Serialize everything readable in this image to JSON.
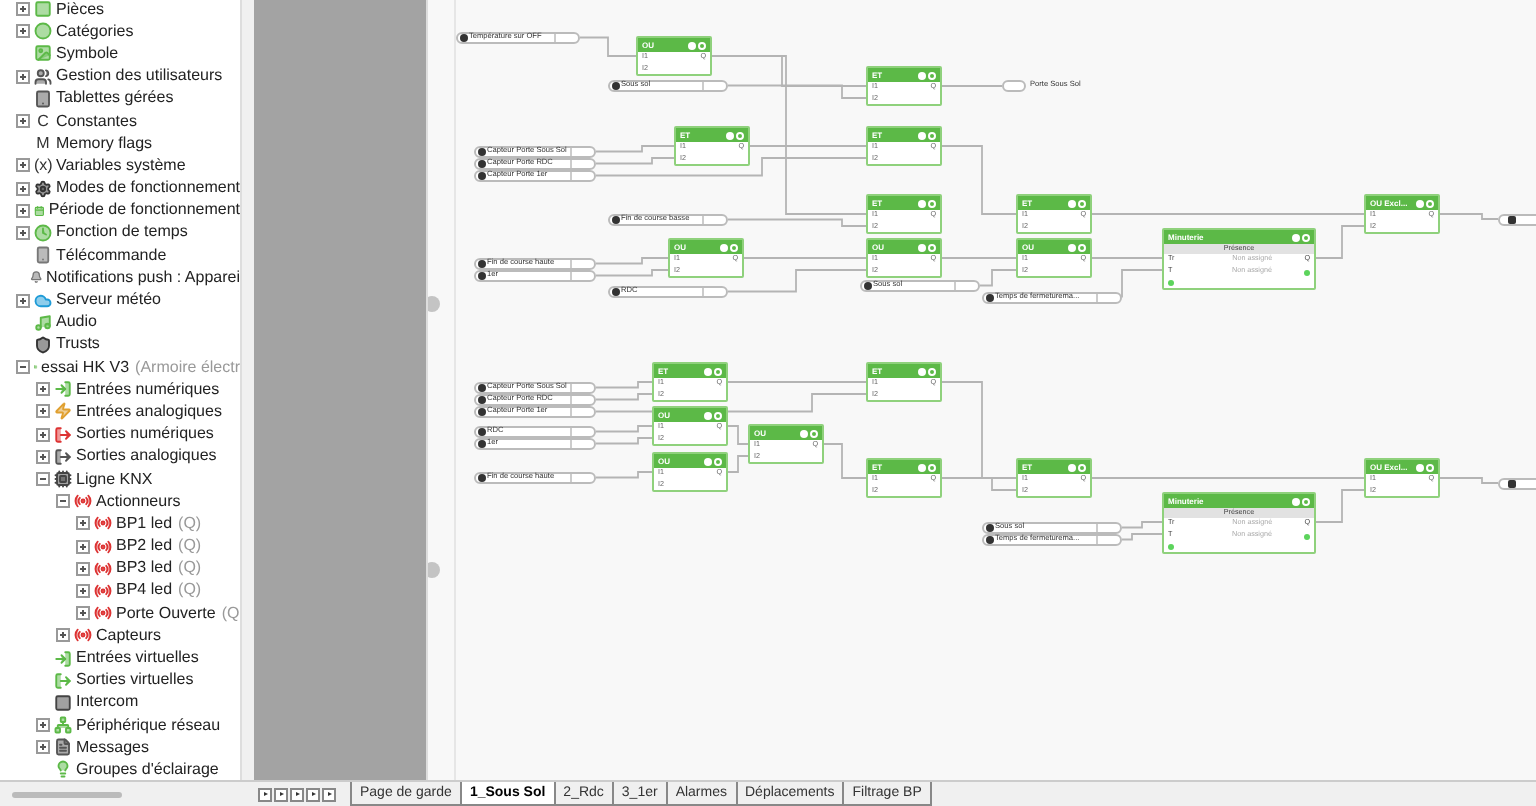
{
  "sidebar": {
    "tree": [
      {
        "label": "Pièces",
        "expanded": false
      },
      {
        "label": "Catégories",
        "expanded": false
      },
      {
        "label": "Symbole"
      },
      {
        "label": "Gestion des utilisateurs",
        "expanded": false
      },
      {
        "label": "Tablettes gérées"
      },
      {
        "label": "Constantes",
        "glyph": "C",
        "expanded": false
      },
      {
        "label": "Memory flags",
        "glyph": "M"
      },
      {
        "label": "Variables système",
        "glyph": "(x)",
        "expanded": false
      },
      {
        "label": "Modes de fonctionnement",
        "expanded": false
      },
      {
        "label": "Période de fonctionnement",
        "expanded": false
      },
      {
        "label": "Fonction de temps",
        "expanded": false
      },
      {
        "label": "Télécommande"
      },
      {
        "label": "Notifications push : Apparei"
      },
      {
        "label": "Serveur météo",
        "expanded": false
      },
      {
        "label": "Audio"
      },
      {
        "label": "Trusts"
      },
      {
        "label": "essai HK V3",
        "suffix": "(Armoire électr",
        "expanded": true,
        "children": [
          {
            "label": "Entrées numériques",
            "expanded": false
          },
          {
            "label": "Entrées analogiques",
            "expanded": false
          },
          {
            "label": "Sorties numériques",
            "expanded": false
          },
          {
            "label": "Sorties analogiques",
            "expanded": false
          },
          {
            "label": "Ligne KNX",
            "expanded": true,
            "children": [
              {
                "label": "Actionneurs",
                "expanded": true,
                "children": [
                  {
                    "label": "BP1 led",
                    "suffix": "(Q)",
                    "expanded": false
                  },
                  {
                    "label": "BP2 led",
                    "suffix": "(Q)",
                    "expanded": false
                  },
                  {
                    "label": "BP3 led",
                    "suffix": "(Q)",
                    "expanded": false
                  },
                  {
                    "label": "BP4 led",
                    "suffix": "(Q)",
                    "expanded": false
                  },
                  {
                    "label": "Porte Ouverte",
                    "suffix": "(Q",
                    "expanded": false
                  }
                ]
              },
              {
                "label": "Capteurs",
                "expanded": false
              }
            ]
          },
          {
            "label": "Entrées virtuelles"
          },
          {
            "label": "Sorties virtuelles"
          },
          {
            "label": "Intercom"
          },
          {
            "label": "Périphérique réseau",
            "expanded": false
          },
          {
            "label": "Messages",
            "expanded": false
          },
          {
            "label": "Groupes d'éclairage"
          }
        ]
      }
    ]
  },
  "diagram": {
    "inputs": [
      {
        "label": "Température sur OFF"
      },
      {
        "label": "Sous sol"
      },
      {
        "label": "Capteur Porte Sous Sol"
      },
      {
        "label": "Capteur Porte RDC"
      },
      {
        "label": "Capteur Porte 1er"
      },
      {
        "label": "Fin de course basse"
      },
      {
        "label": "Fin de course haute"
      },
      {
        "label": "1er"
      },
      {
        "label": "RDC"
      },
      {
        "label": "Sous sol"
      },
      {
        "label": "Temps de fermeturema..."
      },
      {
        "label": "Capteur Porte Sous Sol"
      },
      {
        "label": "Capteur Porte RDC"
      },
      {
        "label": "Capteur Porte 1er"
      },
      {
        "label": "RDC"
      },
      {
        "label": "1er"
      },
      {
        "label": "Fin de course haute"
      },
      {
        "label": "Sous sol"
      },
      {
        "label": "Temps de fermeturema..."
      }
    ],
    "outputs": [
      {
        "label": "Porte Sous Sol"
      }
    ],
    "blocks": [
      {
        "kind": "logic",
        "title": "OU",
        "inputs": [
          "I1",
          "I2"
        ],
        "output": "Q"
      },
      {
        "kind": "logic",
        "title": "ET",
        "inputs": [
          "I1",
          "I2"
        ],
        "output": "Q"
      },
      {
        "kind": "logic",
        "title": "ET",
        "inputs": [
          "I1",
          "I2"
        ],
        "output": "Q"
      },
      {
        "kind": "logic",
        "title": "ET",
        "inputs": [
          "I1",
          "I2"
        ],
        "output": "Q"
      },
      {
        "kind": "logic",
        "title": "ET",
        "inputs": [
          "I1",
          "I2"
        ],
        "output": "Q"
      },
      {
        "kind": "logic",
        "title": "ET",
        "inputs": [
          "I1",
          "I2"
        ],
        "output": "Q"
      },
      {
        "kind": "logic",
        "title": "OU Excl...",
        "inputs": [
          "I1",
          "I2"
        ],
        "output": "Q"
      },
      {
        "kind": "logic",
        "title": "OU",
        "inputs": [
          "I1",
          "I2"
        ],
        "output": "Q"
      },
      {
        "kind": "logic",
        "title": "OU",
        "inputs": [
          "I1",
          "I2"
        ],
        "output": "Q"
      },
      {
        "kind": "logic",
        "title": "OU",
        "inputs": [
          "I1",
          "I2"
        ],
        "output": "Q"
      },
      {
        "kind": "timer",
        "title": "Minuterie",
        "subtitle": "Présence",
        "rows": [
          {
            "pin": "Tr",
            "value": "Non assigné",
            "output": "Q"
          },
          {
            "pin": "T",
            "value": "Non assigné"
          }
        ]
      },
      {
        "kind": "logic",
        "title": "ET",
        "inputs": [
          "I1",
          "I2"
        ],
        "output": "Q"
      },
      {
        "kind": "logic",
        "title": "ET",
        "inputs": [
          "I1",
          "I2"
        ],
        "output": "Q"
      },
      {
        "kind": "logic",
        "title": "OU",
        "inputs": [
          "I1",
          "I2"
        ],
        "output": "Q"
      },
      {
        "kind": "logic",
        "title": "OU",
        "inputs": [
          "I1",
          "I2"
        ],
        "output": "Q"
      },
      {
        "kind": "logic",
        "title": "OU",
        "inputs": [
          "I1",
          "I2"
        ],
        "output": "Q"
      },
      {
        "kind": "logic",
        "title": "ET",
        "inputs": [
          "I1",
          "I2"
        ],
        "output": "Q"
      },
      {
        "kind": "logic",
        "title": "ET",
        "inputs": [
          "I1",
          "I2"
        ],
        "output": "Q"
      },
      {
        "kind": "logic",
        "title": "OU Excl...",
        "inputs": [
          "I1",
          "I2"
        ],
        "output": "Q"
      },
      {
        "kind": "timer",
        "title": "Minuterie",
        "subtitle": "Présence",
        "rows": [
          {
            "pin": "Tr",
            "value": "Non assigné",
            "output": "Q"
          },
          {
            "pin": "T",
            "value": "Non assigné"
          }
        ]
      }
    ]
  },
  "tabs": [
    {
      "label": "Page de garde",
      "selected": false
    },
    {
      "label": "1_Sous Sol",
      "selected": true
    },
    {
      "label": "2_Rdc",
      "selected": false
    },
    {
      "label": "3_1er",
      "selected": false
    },
    {
      "label": "Alarmes",
      "selected": false
    },
    {
      "label": "Déplacements",
      "selected": false
    },
    {
      "label": "Filtrage BP",
      "selected": false
    }
  ]
}
